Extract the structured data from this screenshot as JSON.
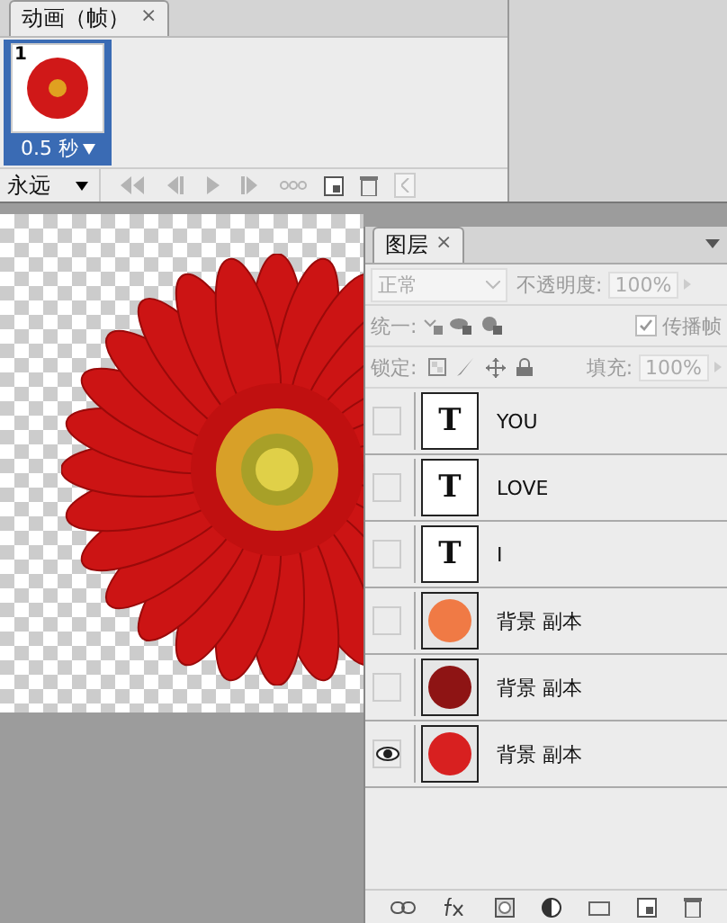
{
  "animation_panel": {
    "tab": {
      "label": "动画（帧）",
      "close": "×"
    },
    "frames": [
      {
        "number": "1",
        "delay": "0.5 秒",
        "selected": true
      }
    ],
    "loop": "永远"
  },
  "layers_panel": {
    "tab": {
      "label": "图层",
      "close": "×"
    },
    "blend_mode": "正常",
    "opacity_label": "不透明度:",
    "opacity": "100%",
    "unify_label": "统一:",
    "propagate": {
      "label": "传播帧",
      "checked": true
    },
    "lock_label": "锁定:",
    "fill_label": "填充:",
    "fill": "100%",
    "layers": [
      {
        "kind": "text",
        "thumb_letter": "T",
        "name": "YOU",
        "visible": false
      },
      {
        "kind": "text",
        "thumb_letter": "T",
        "name": "LOVE",
        "visible": false
      },
      {
        "kind": "text",
        "thumb_letter": "T",
        "name": "I",
        "visible": false
      },
      {
        "kind": "image",
        "name": "背景 副本",
        "visible": false,
        "color": "#f07a45"
      },
      {
        "kind": "image",
        "name": "背景 副本",
        "visible": false,
        "color": "#8e1414"
      },
      {
        "kind": "image",
        "name": "背景 副本",
        "visible": true,
        "color": "#d82020"
      }
    ]
  }
}
